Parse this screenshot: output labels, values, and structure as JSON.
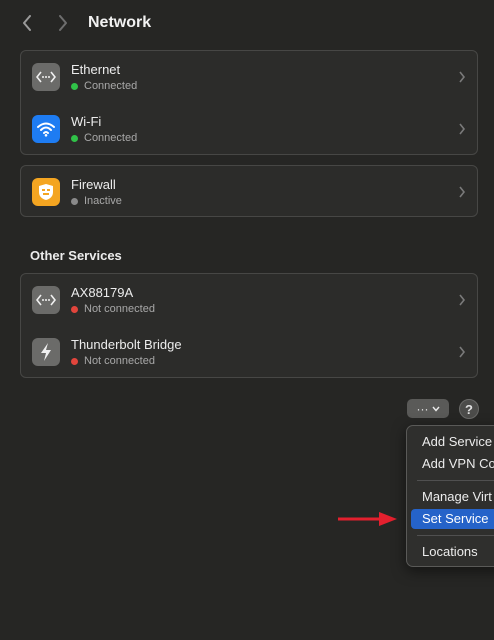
{
  "header": {
    "title": "Network",
    "back_icon": "chevron-left-icon",
    "forward_icon": "chevron-right-icon"
  },
  "services": [
    {
      "name": "Ethernet",
      "status": "Connected",
      "status_color": "#30c248",
      "icon": "ethernet-icon"
    },
    {
      "name": "Wi-Fi",
      "status": "Connected",
      "status_color": "#30c248",
      "icon": "wifi-icon"
    }
  ],
  "firewall": {
    "name": "Firewall",
    "status": "Inactive",
    "status_color": "#8a8a8a",
    "icon": "firewall-icon"
  },
  "other_services": {
    "title": "Other Services",
    "items": [
      {
        "name": "AX88179A",
        "status": "Not connected",
        "status_color": "#e2453c",
        "icon": "ethernet-icon"
      },
      {
        "name": "Thunderbolt Bridge",
        "status": "Not connected",
        "status_color": "#e2453c",
        "icon": "thunderbolt-icon"
      }
    ]
  },
  "toolbar": {
    "more_label": "···",
    "help_label": "?"
  },
  "menu": {
    "items": [
      {
        "label": "Add Service"
      },
      {
        "label": "Add VPN Co"
      },
      {
        "label": "Manage Virt"
      },
      {
        "label": "Set Service",
        "selected": true
      },
      {
        "label": "Locations"
      }
    ]
  },
  "colors": {
    "accent": "#2563c9",
    "arrow": "#e3202e",
    "ethernet_icon_bg": "#6b6b69",
    "wifi_icon_bg": "#1e7cf2",
    "firewall_icon_bg": "#f4a521",
    "thunderbolt_icon_bg": "#6b6b69"
  }
}
